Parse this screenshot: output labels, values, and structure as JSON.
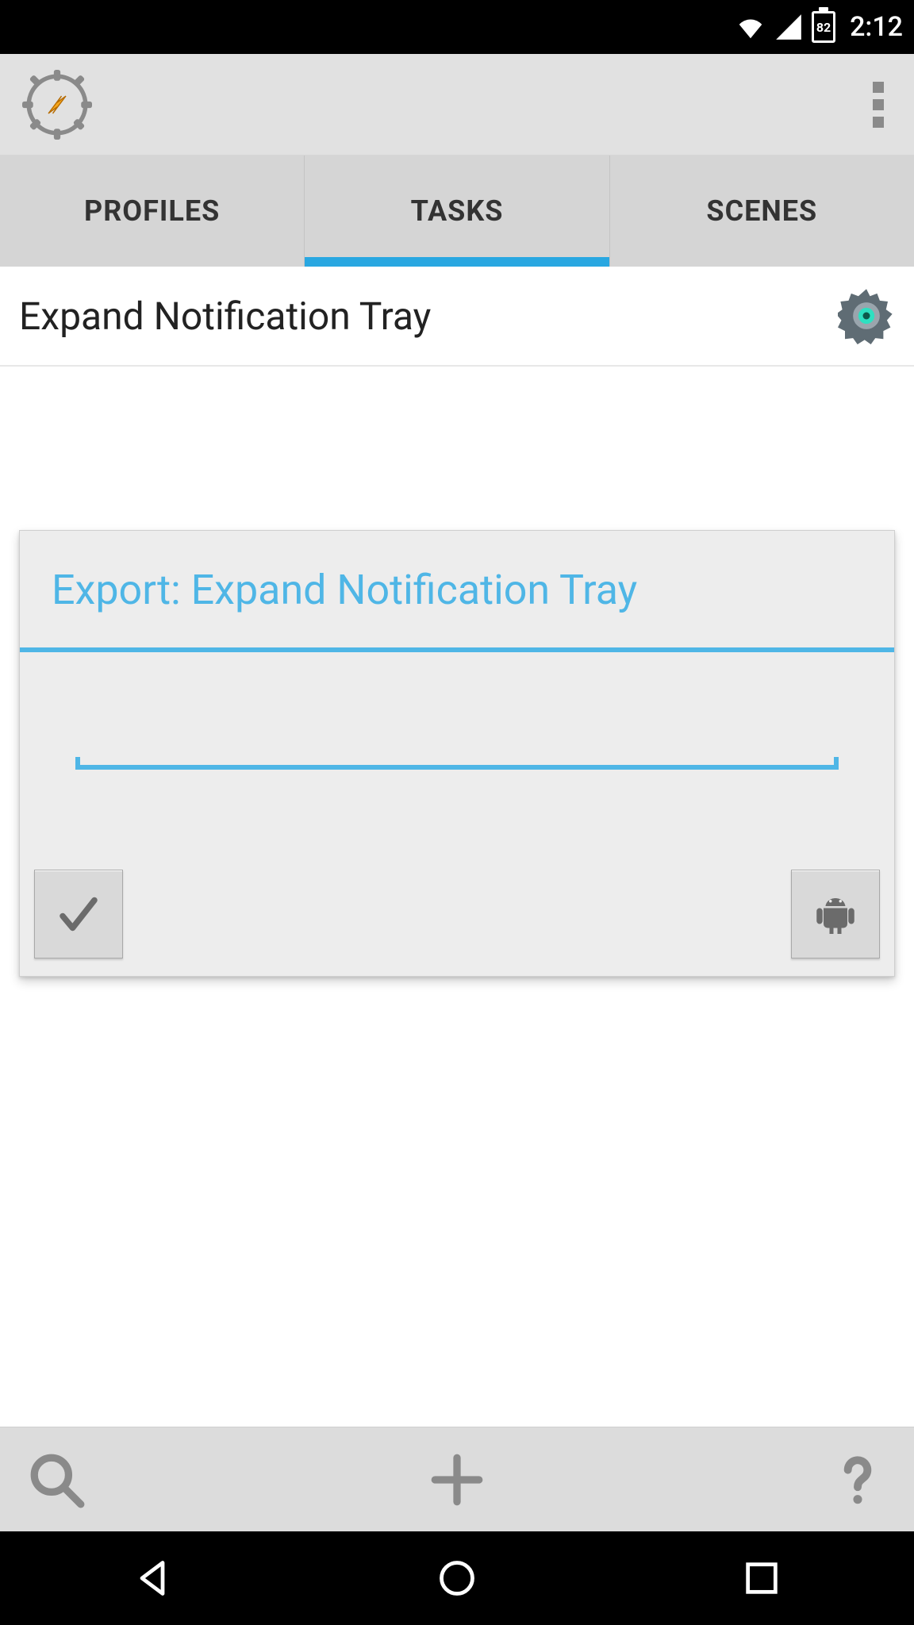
{
  "status_bar": {
    "battery_pct": "82",
    "time": "2:12"
  },
  "tabs": {
    "profiles": "PROFILES",
    "tasks": "TASKS",
    "scenes": "SCENES",
    "active": "tasks"
  },
  "task_list": {
    "items": [
      {
        "title": "Expand Notification Tray"
      }
    ]
  },
  "dialog": {
    "title": "Export: Expand Notification Tray",
    "input_value": ""
  }
}
